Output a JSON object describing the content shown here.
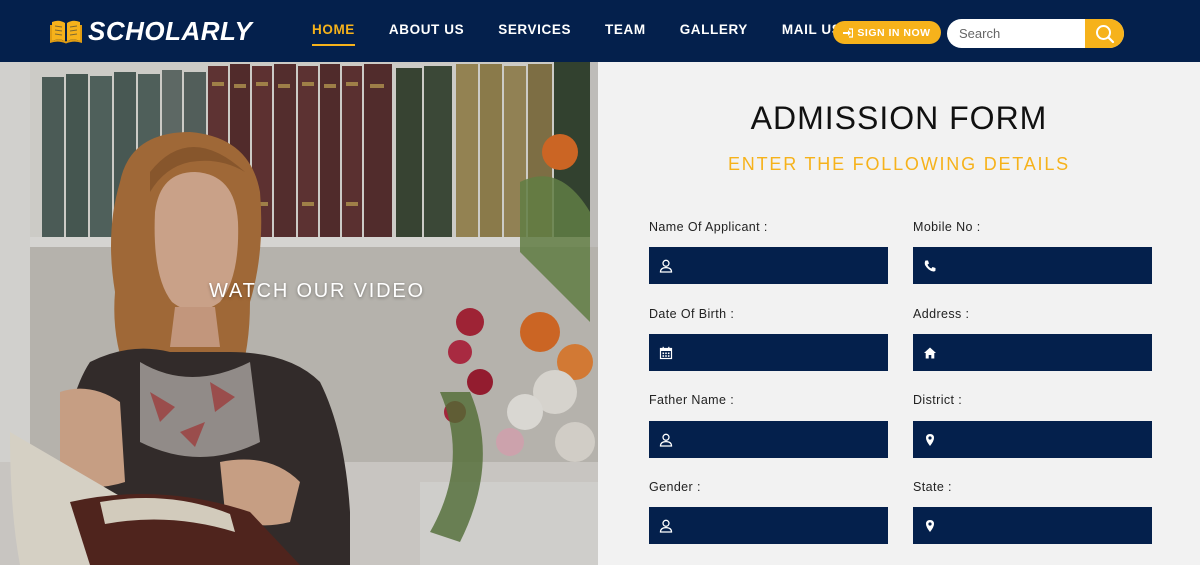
{
  "header": {
    "brand": "SCHOLARLY",
    "nav": [
      {
        "label": "HOME",
        "active": true
      },
      {
        "label": "ABOUT US",
        "active": false
      },
      {
        "label": "SERVICES",
        "active": false
      },
      {
        "label": "TEAM",
        "active": false
      },
      {
        "label": "GALLERY",
        "active": false
      },
      {
        "label": "MAIL US",
        "active": false
      }
    ],
    "signin_label": "SIGN IN NOW",
    "search_placeholder": "Search"
  },
  "hero": {
    "watch_video": "WATCH OUR VIDEO"
  },
  "form": {
    "title": "ADMISSION FORM",
    "subtitle": "ENTER THE FOLLOWING DETAILS",
    "fields": [
      {
        "label": "Name Of Applicant :",
        "icon": "user-icon",
        "value": ""
      },
      {
        "label": "Mobile No :",
        "icon": "phone-icon",
        "value": ""
      },
      {
        "label": "Date Of Birth :",
        "icon": "calendar-icon",
        "value": ""
      },
      {
        "label": "Address :",
        "icon": "home-icon",
        "value": ""
      },
      {
        "label": "Father Name :",
        "icon": "user-icon",
        "value": ""
      },
      {
        "label": "District :",
        "icon": "map-marker-icon",
        "value": ""
      },
      {
        "label": "Gender :",
        "icon": "user-icon",
        "value": ""
      },
      {
        "label": "State :",
        "icon": "map-marker-icon",
        "value": ""
      }
    ]
  },
  "colors": {
    "navy": "#04204c",
    "accent": "#f6b21b",
    "panel_bg": "#f2f2f2"
  }
}
